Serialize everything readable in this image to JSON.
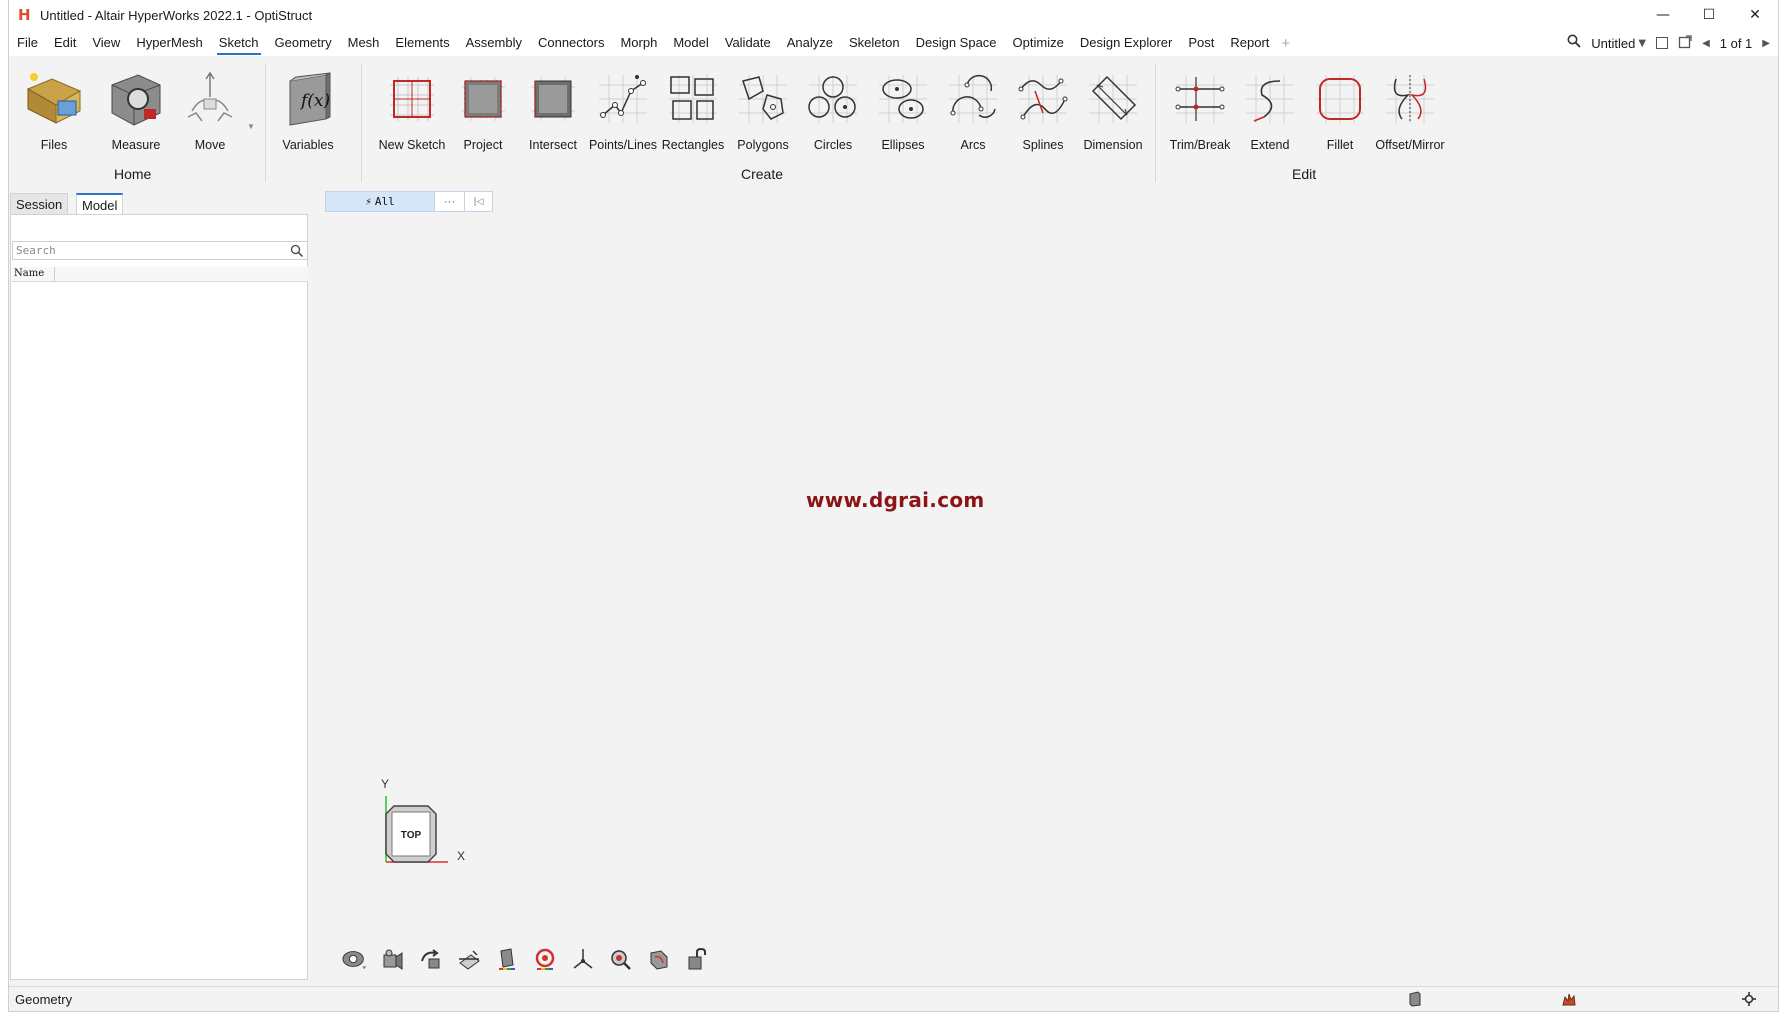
{
  "window": {
    "title": "Untitled - Altair HyperWorks 2022.1 - OptiStruct",
    "logo": "H",
    "controls": [
      "—",
      "☐",
      "✕"
    ]
  },
  "menu": {
    "items": [
      "File",
      "Edit",
      "View",
      "HyperMesh",
      "Sketch",
      "Geometry",
      "Mesh",
      "Elements",
      "Assembly",
      "Connectors",
      "Morph",
      "Model",
      "Validate",
      "Analyze",
      "Skeleton",
      "Design Space",
      "Optimize",
      "Design Explorer",
      "Post",
      "Report"
    ],
    "active": "Sketch",
    "add_symbol": "+",
    "doc_name": "Untitled",
    "page_indicator": "1 of 1"
  },
  "ribbon": {
    "groups": {
      "home": "Home",
      "create": "Create",
      "edit": "Edit"
    },
    "tools": {
      "files": "Files",
      "measure": "Measure",
      "move": "Move",
      "variables": "Variables",
      "new_sketch": "New Sketch",
      "project": "Project",
      "intersect": "Intersect",
      "points_lines": "Points/Lines",
      "rectangles": "Rectangles",
      "polygons": "Polygons",
      "circles": "Circles",
      "ellipses": "Ellipses",
      "arcs": "Arcs",
      "splines": "Splines",
      "dimension": "Dimension",
      "trim_break": "Trim/Break",
      "extend": "Extend",
      "fillet": "Fillet",
      "offset_mirror": "Offset/Mirror"
    },
    "variables_glyph": "f(x)"
  },
  "panel": {
    "tabs": {
      "session": "Session",
      "model": "Model"
    },
    "active_tab": "Model",
    "close": "✕",
    "search_placeholder": "Search",
    "column_name": "Name"
  },
  "viewport": {
    "filter_label": "All",
    "filter_more": "···",
    "filter_end": "|◁",
    "watermark": "www.dgrai.com",
    "triad": {
      "y": "Y",
      "x": "X",
      "cube": "TOP"
    }
  },
  "status": {
    "text": "Geometry"
  },
  "colors": {
    "accent": "#2b73c9",
    "brand": "#e04b2a",
    "watermark": "#8b1414",
    "axis_x": "#e03030",
    "axis_y": "#38c038"
  }
}
